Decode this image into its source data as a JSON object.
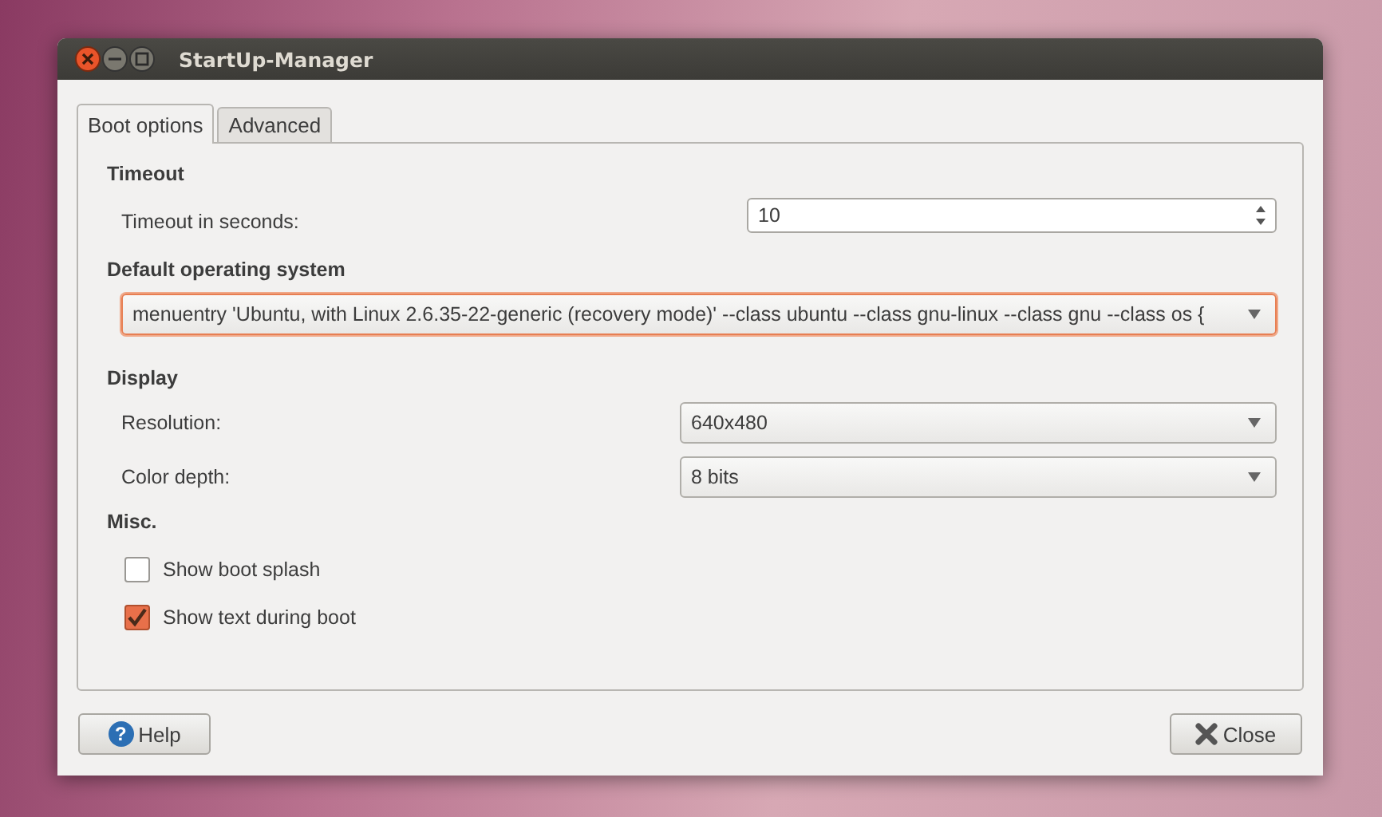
{
  "window": {
    "title": "StartUp-Manager"
  },
  "tabs": [
    {
      "label": "Boot options",
      "selected": true
    },
    {
      "label": "Advanced",
      "selected": false
    }
  ],
  "sections": [
    {
      "heading": "Timeout",
      "rows": [
        {
          "kind": "spin",
          "label": "Timeout in seconds:",
          "value": "10"
        }
      ]
    },
    {
      "heading": "Default operating system",
      "rows": [
        {
          "kind": "wide-combo",
          "value": "menuentry 'Ubuntu, with Linux 2.6.35-22-generic (recovery mode)' --class ubuntu --class gnu-linux --class gnu --class os {",
          "focused": true
        }
      ]
    },
    {
      "heading": "Display",
      "rows": [
        {
          "kind": "combo",
          "label": "Resolution:",
          "value": "640x480"
        },
        {
          "kind": "combo",
          "label": "Color depth:",
          "value": "8 bits"
        }
      ]
    },
    {
      "heading": "Misc.",
      "rows": [
        {
          "kind": "check",
          "label": "Show boot splash",
          "checked": false
        },
        {
          "kind": "check",
          "label": "Show text during boot",
          "checked": true
        }
      ]
    }
  ],
  "help_button": {
    "icon": "?",
    "label": "Help"
  },
  "close_button": {
    "label": "Close"
  }
}
